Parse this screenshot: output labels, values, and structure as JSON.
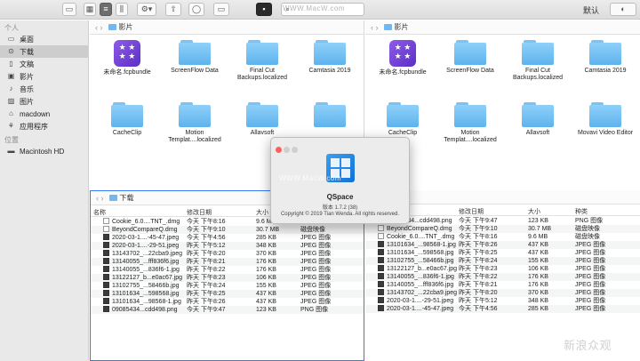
{
  "toolbar": {
    "sort_label": "默认",
    "search_placeholder": ""
  },
  "sidebar": {
    "section_personal": "个人",
    "items": [
      "桌面",
      "下载",
      "文稿",
      "影片",
      "音乐",
      "图片",
      "macdown",
      "应用程序"
    ],
    "section_locations": "位置",
    "locations": [
      "Macintosh HD"
    ]
  },
  "pane_left": {
    "path": "影片"
  },
  "pane_right": {
    "path": "影片"
  },
  "icons_left": [
    {
      "label": "未命名.fcpbundle",
      "kind": "app"
    },
    {
      "label": "ScreenFlow Data",
      "kind": "folder"
    },
    {
      "label": "Final Cut Backups.localized",
      "kind": "folder"
    },
    {
      "label": "Camtasia 2019",
      "kind": "folder"
    },
    {
      "label": "CacheClip",
      "kind": "folder"
    },
    {
      "label": "Motion Templat....localized",
      "kind": "folder"
    },
    {
      "label": "Allavsoft",
      "kind": "folder"
    },
    {
      "label": "",
      "kind": "folder"
    }
  ],
  "icons_right": [
    {
      "label": "未命名.fcpbundle",
      "kind": "app"
    },
    {
      "label": "ScreenFlow Data",
      "kind": "folder"
    },
    {
      "label": "Final Cut Backups.localized",
      "kind": "folder"
    },
    {
      "label": "Camtasia 2019",
      "kind": "folder"
    },
    {
      "label": "CacheClip",
      "kind": "folder"
    },
    {
      "label": "Motion Templat....localized",
      "kind": "folder"
    },
    {
      "label": "Allavsoft",
      "kind": "folder"
    },
    {
      "label": "Movavi Video Editor",
      "kind": "folder"
    }
  ],
  "list_left": {
    "path": "下载",
    "columns": [
      "名称",
      "修改日期",
      "大小",
      ""
    ],
    "rows": [
      [
        "Cookie_6.0....TNT_.dmg",
        "今天 下午8:16",
        "9.6 MB",
        ""
      ],
      [
        "BeyondCompareQ.dmg",
        "今天 下午9:10",
        "30.7 MB",
        "磁盘映像"
      ],
      [
        "2020-03-1....-45-47.jpeg",
        "今天 下午4:56",
        "285 KB",
        "JPEG 图像"
      ],
      [
        "2020-03-1....-29-51.jpeg",
        "昨天 下午5:12",
        "348 KB",
        "JPEG 图像"
      ],
      [
        "13143702_...22cba9.jpeg",
        "昨天 下午8:20",
        "370 KB",
        "JPEG 图像"
      ],
      [
        "13140055_...fff836f6.jpg",
        "昨天 下午8:21",
        "176 KB",
        "JPEG 图像"
      ],
      [
        "13140055_...836f6-1.jpg",
        "昨天 下午8:22",
        "176 KB",
        "JPEG 图像"
      ],
      [
        "13122127_b...e0ac67.jpg",
        "昨天 下午8:23",
        "106 KB",
        "JPEG 图像"
      ],
      [
        "13102755_...58466b.jpg",
        "昨天 下午8:24",
        "155 KB",
        "JPEG 图像"
      ],
      [
        "13101634_...598568.jpg",
        "昨天 下午8:25",
        "437 KB",
        "JPEG 图像"
      ],
      [
        "13101634_...98568-1.jpg",
        "昨天 下午8:26",
        "437 KB",
        "JPEG 图像"
      ],
      [
        "09085434...cdd498.png",
        "今天 下午9:47",
        "123 KB",
        "PNG 图像"
      ]
    ]
  },
  "list_right": {
    "columns": [
      "",
      "修改日期",
      "大小",
      "种类"
    ],
    "rows": [
      [
        "09085434...cdd498.png",
        "今天 下午9:47",
        "123 KB",
        "PNG 图像"
      ],
      [
        "BeyondCompareQ.dmg",
        "今天 下午9:10",
        "30.7 MB",
        "磁盘映像"
      ],
      [
        "Cookie_6.0....TNT_.dmg",
        "今天 下午8:16",
        "9.6 MB",
        "磁盘映像"
      ],
      [
        "13101634_...98568-1.jpg",
        "昨天 下午8:26",
        "437 KB",
        "JPEG 图像"
      ],
      [
        "13101634_...598568.jpg",
        "昨天 下午8:25",
        "437 KB",
        "JPEG 图像"
      ],
      [
        "13102755_...58466b.jpg",
        "昨天 下午8:24",
        "155 KB",
        "JPEG 图像"
      ],
      [
        "13122127_b...e0ac67.jpg",
        "昨天 下午8:23",
        "106 KB",
        "JPEG 图像"
      ],
      [
        "13140055_...836f6-1.jpg",
        "昨天 下午8:22",
        "176 KB",
        "JPEG 图像"
      ],
      [
        "13140055_...fff836f6.jpg",
        "昨天 下午8:21",
        "176 KB",
        "JPEG 图像"
      ],
      [
        "13143702_...22cba9.jpeg",
        "昨天 下午8:20",
        "370 KB",
        "JPEG 图像"
      ],
      [
        "2020-03-1....-29-51.jpeg",
        "昨天 下午5:12",
        "348 KB",
        "JPEG 图像"
      ],
      [
        "2020-03-1....-45-47.jpeg",
        "今天 下午4:56",
        "285 KB",
        "JPEG 图像"
      ]
    ]
  },
  "dialog": {
    "app_name": "QSpace",
    "version": "版本 1.7.2 (38)",
    "copyright": "Copyright © 2019 Tian Wenda. All rights reserved."
  },
  "watermark": {
    "site": "WWW.MacW.com",
    "corner": "新浪众观"
  },
  "colors": {
    "accent": "#3478f6",
    "folder": "#6fb8f0",
    "selection": "#cdcdcd"
  }
}
